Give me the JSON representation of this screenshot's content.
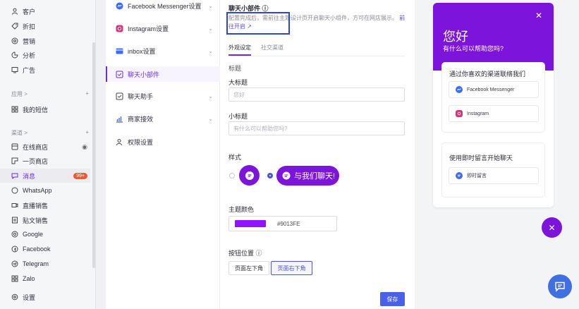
{
  "nav": {
    "items": [
      {
        "label": "客户",
        "icon": "user-icon"
      },
      {
        "label": "折扣",
        "icon": "tag-icon"
      },
      {
        "label": "营销",
        "icon": "target-icon"
      },
      {
        "label": "分析",
        "icon": "chart-icon"
      },
      {
        "label": "广告",
        "icon": "ad-icon"
      }
    ],
    "apps_label": "应用 >",
    "apps_items": [
      {
        "label": "我的短信",
        "icon": "grid-icon"
      }
    ],
    "channels_label": "渠道 >",
    "channel_items": [
      {
        "label": "在线商店",
        "icon": "store-icon"
      },
      {
        "label": "一页商店",
        "icon": "page-icon"
      },
      {
        "label": "消息",
        "icon": "message-icon",
        "badge": "99+"
      },
      {
        "label": "WhatsApp",
        "icon": "whatsapp-icon"
      },
      {
        "label": "直播销售",
        "icon": "live-icon"
      },
      {
        "label": "贴文销售",
        "icon": "post-icon"
      },
      {
        "label": "Google",
        "icon": "google-icon"
      },
      {
        "label": "Facebook",
        "icon": "facebook-icon"
      },
      {
        "label": "Telegram",
        "icon": "telegram-icon"
      },
      {
        "label": "Zalo",
        "icon": "zalo-icon"
      }
    ],
    "settings_label": "设置"
  },
  "submenu": {
    "items": [
      {
        "label": "Facebook Messenger设置",
        "chevron": true
      },
      {
        "label": "Instagram设置",
        "chevron": true
      },
      {
        "label": "inbox设置",
        "chevron": true
      },
      {
        "label": "聊天小部件",
        "active": true
      },
      {
        "label": "聊天助手",
        "chevron": true
      },
      {
        "label": "商家接效",
        "chevron": true
      },
      {
        "label": "权限设置"
      }
    ]
  },
  "main": {
    "section_title": "聊天小部件 ⓘ",
    "note_text": "配置完成后，需前往主题设计页开启聊天小组件，方可在网店展示。",
    "note_link": "前往开启 ↗",
    "tabs": [
      "外观设定",
      "社交渠道"
    ],
    "heading_label": "标题",
    "title_label": "大标题",
    "title_placeholder": "您好",
    "subtitle_label": "小标题",
    "subtitle_placeholder": "有什么可以帮助您吗?",
    "style_label": "样式",
    "pill_text": "与我们聊天!",
    "theme_color_label": "主题颜色",
    "theme_color": "#9013FE",
    "button_position_label": "按钮位置 ⓘ",
    "pos_left": "页面左下角",
    "pos_right": "页面右下角",
    "save_label": "保存"
  },
  "preview": {
    "title": "您好",
    "subtitle": "有什么可以帮助您吗?",
    "card1_title": "通过你喜欢的渠道联络我们",
    "channels": [
      "Facebook Messenger",
      "Instagram"
    ],
    "card2_title": "使用即时留言开始聊天",
    "instant_label": "即时留言"
  },
  "colors": {
    "accent": "#7d14db",
    "primary": "#4a60e8",
    "highlight": "#2c46d6"
  }
}
